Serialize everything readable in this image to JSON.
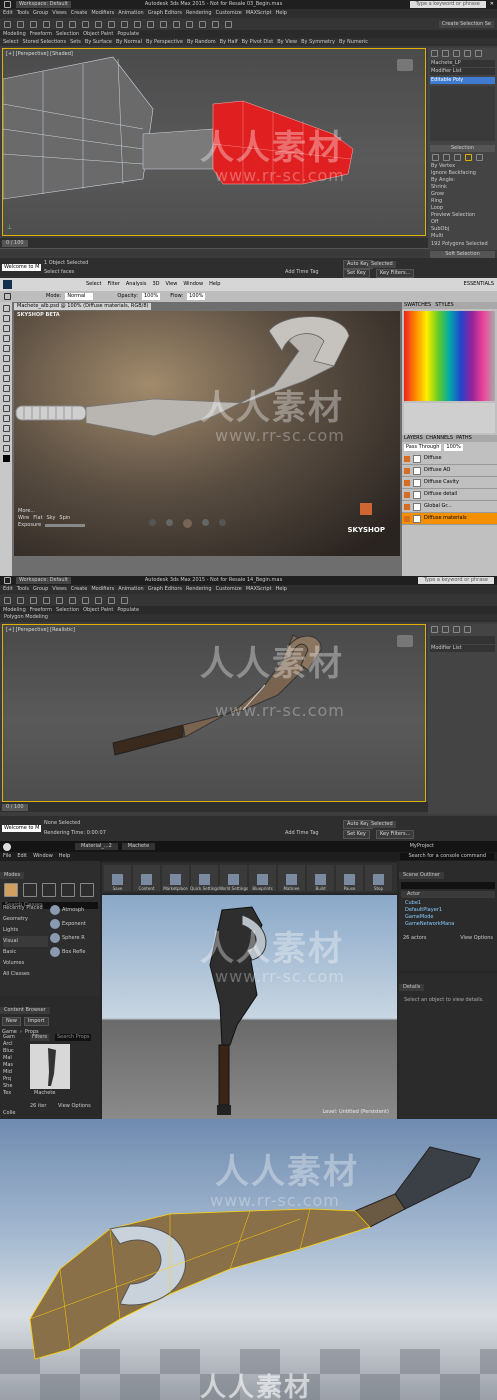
{
  "max1": {
    "title": "Autodesk 3ds Max 2015 - Not for Resale 03_Begin.max",
    "workspace": "Workspace: Default",
    "search": "Type a keyword or phrase",
    "menu": [
      "Edit",
      "Tools",
      "Group",
      "Views",
      "Create",
      "Modifiers",
      "Animation",
      "Graph Editors",
      "Rendering",
      "Customize",
      "MAXScript",
      "Help"
    ],
    "ribbon_tabs": [
      "Modeling",
      "Freeform",
      "Selection",
      "Object Paint",
      "Populate"
    ],
    "sub_tabs": [
      "Select",
      "Stored Selections",
      "Sets",
      "By Surface",
      "By Normal",
      "By Perspective",
      "By Random",
      "By Half",
      "By Pivot Dist",
      "By View",
      "By Symmetry",
      "By Numeric"
    ],
    "viewport_label": "[+] [Perspective] [Shaded]",
    "modifier_name": "Machete_LP",
    "modifier_list": "Modifier List",
    "modifier_item": "Editable Poly",
    "selection_header": "Selection",
    "sel_options": [
      "By Vertex",
      "Ignore Backfacing",
      "By Angle:",
      "Shrink",
      "Grow",
      "Ring",
      "Loop",
      "Preview Selection",
      "Off",
      "SubObj",
      "Multi"
    ],
    "poly_count": "192 Polygons Selected",
    "soft_selection": "Soft Selection",
    "timeline": "0 / 100",
    "status_left": "Welcome to M",
    "status1": "1 Object Selected",
    "status2": "Select faces",
    "autokey": "Auto Key",
    "selected": "Selected",
    "setkey": "Set Key",
    "keyfilters": "Key Filters...",
    "add_time_tag": "Add Time Tag",
    "create_sel_set": "Create Selection Se"
  },
  "ps": {
    "menu": [
      "Select",
      "Filter",
      "Analysis",
      "3D",
      "View",
      "Window",
      "Help"
    ],
    "essentials": "ESSENTIALS",
    "mode_label": "Mode:",
    "mode_value": "Normal",
    "opacity_label": "Opacity:",
    "opacity_value": "100%",
    "flow_label": "Flow:",
    "flow_value": "100%",
    "doc_tab": "Machete_alb.psd @ 100% (Diffuse materials, RGB/8)",
    "skyshop_title": "SKYSHOP BETA",
    "skyshop_logo": "SKYSHOP",
    "more": "More...",
    "wire": "Wire",
    "flat": "Flat",
    "sky": "Sky",
    "spin": "Spin",
    "exposure": "Exposure",
    "panel_tabs": [
      "SWATCHES",
      "STYLES"
    ],
    "layers_tabs": [
      "LAYERS",
      "CHANNELS",
      "PATHS"
    ],
    "blend": "Pass Through",
    "opacity2": "100%",
    "layers": [
      "Diffuse",
      "Diffuse AO",
      "Diffuse Cavity",
      "Diffuse detail",
      "Global Gr...",
      "Diffuse materials"
    ],
    "hand_label": "Hand"
  },
  "max2": {
    "title": "Autodesk 3ds Max 2015 - Not for Resale 14_Begin.max",
    "workspace": "Workspace: Default",
    "search": "Type a keyword or phrase",
    "menu": [
      "Edit",
      "Tools",
      "Group",
      "Views",
      "Create",
      "Modifiers",
      "Animation",
      "Graph Editors",
      "Rendering",
      "Customize",
      "MAXScript",
      "Help"
    ],
    "ribbon_tabs": [
      "Modeling",
      "Freeform",
      "Selection",
      "Object Paint",
      "Populate"
    ],
    "ribbon_sub": "Polygon Modeling",
    "viewport_label": "[+] [Perspective] [Realistic]",
    "modifier_list": "Modifier List",
    "timeline": "0 / 100",
    "status_left": "Welcome to M",
    "status1": "None Selected",
    "status2": "Rendering Time: 0:00:07",
    "autokey": "Auto Key",
    "selected": "Selected",
    "setkey": "Set Key",
    "keyfilters": "Key Filters...",
    "add_time_tag": "Add Time Tag"
  },
  "ue": {
    "tabs": [
      "Material_...2",
      "Machete"
    ],
    "project": "MyProject",
    "search_cmd": "Search for a console command",
    "menu": [
      "File",
      "Edit",
      "Window",
      "Help"
    ],
    "modes": "Modes",
    "search_classes": "Search Classes",
    "categories": [
      "Recently Placed",
      "Geometry",
      "Lights",
      "Visual",
      "Basic",
      "Volumes",
      "All Classes"
    ],
    "placeables": [
      "Atmosph",
      "Exponent",
      "Sphere R",
      "Box Refle"
    ],
    "toolbar": [
      "Save",
      "Content",
      "Marketplace",
      "Quick Settings",
      "World Settings",
      "Blueprints",
      "Matinee",
      "Build",
      "Pause",
      "Stop"
    ],
    "content_browser": "Content Browser",
    "new": "New",
    "import": "Import",
    "path": [
      "Game",
      "Props"
    ],
    "filters": "Filters",
    "search_props": "Search Props",
    "asset_name": "Machete",
    "item_count": "26 iter",
    "view_options": "View Options",
    "folders": [
      "Gam",
      "Arcl",
      "Bluc",
      "Mal",
      "Mas",
      "Mid",
      "Prq",
      "She",
      "Tex"
    ],
    "collections": "Colle",
    "scene_outliner": "Scene Outliner",
    "outliner_actor": "Actor",
    "outliner_items": [
      "Cube1",
      "DefaultPlayer1",
      "GameMode",
      "GameNetworkMana"
    ],
    "actors_count": "26 actors",
    "details": "Details",
    "details_msg": "Select an object to view details.",
    "level": "Level: Untitled (Persistent)"
  },
  "watermark": {
    "cn": "人人素材",
    "url": "www.rr-sc.com"
  }
}
